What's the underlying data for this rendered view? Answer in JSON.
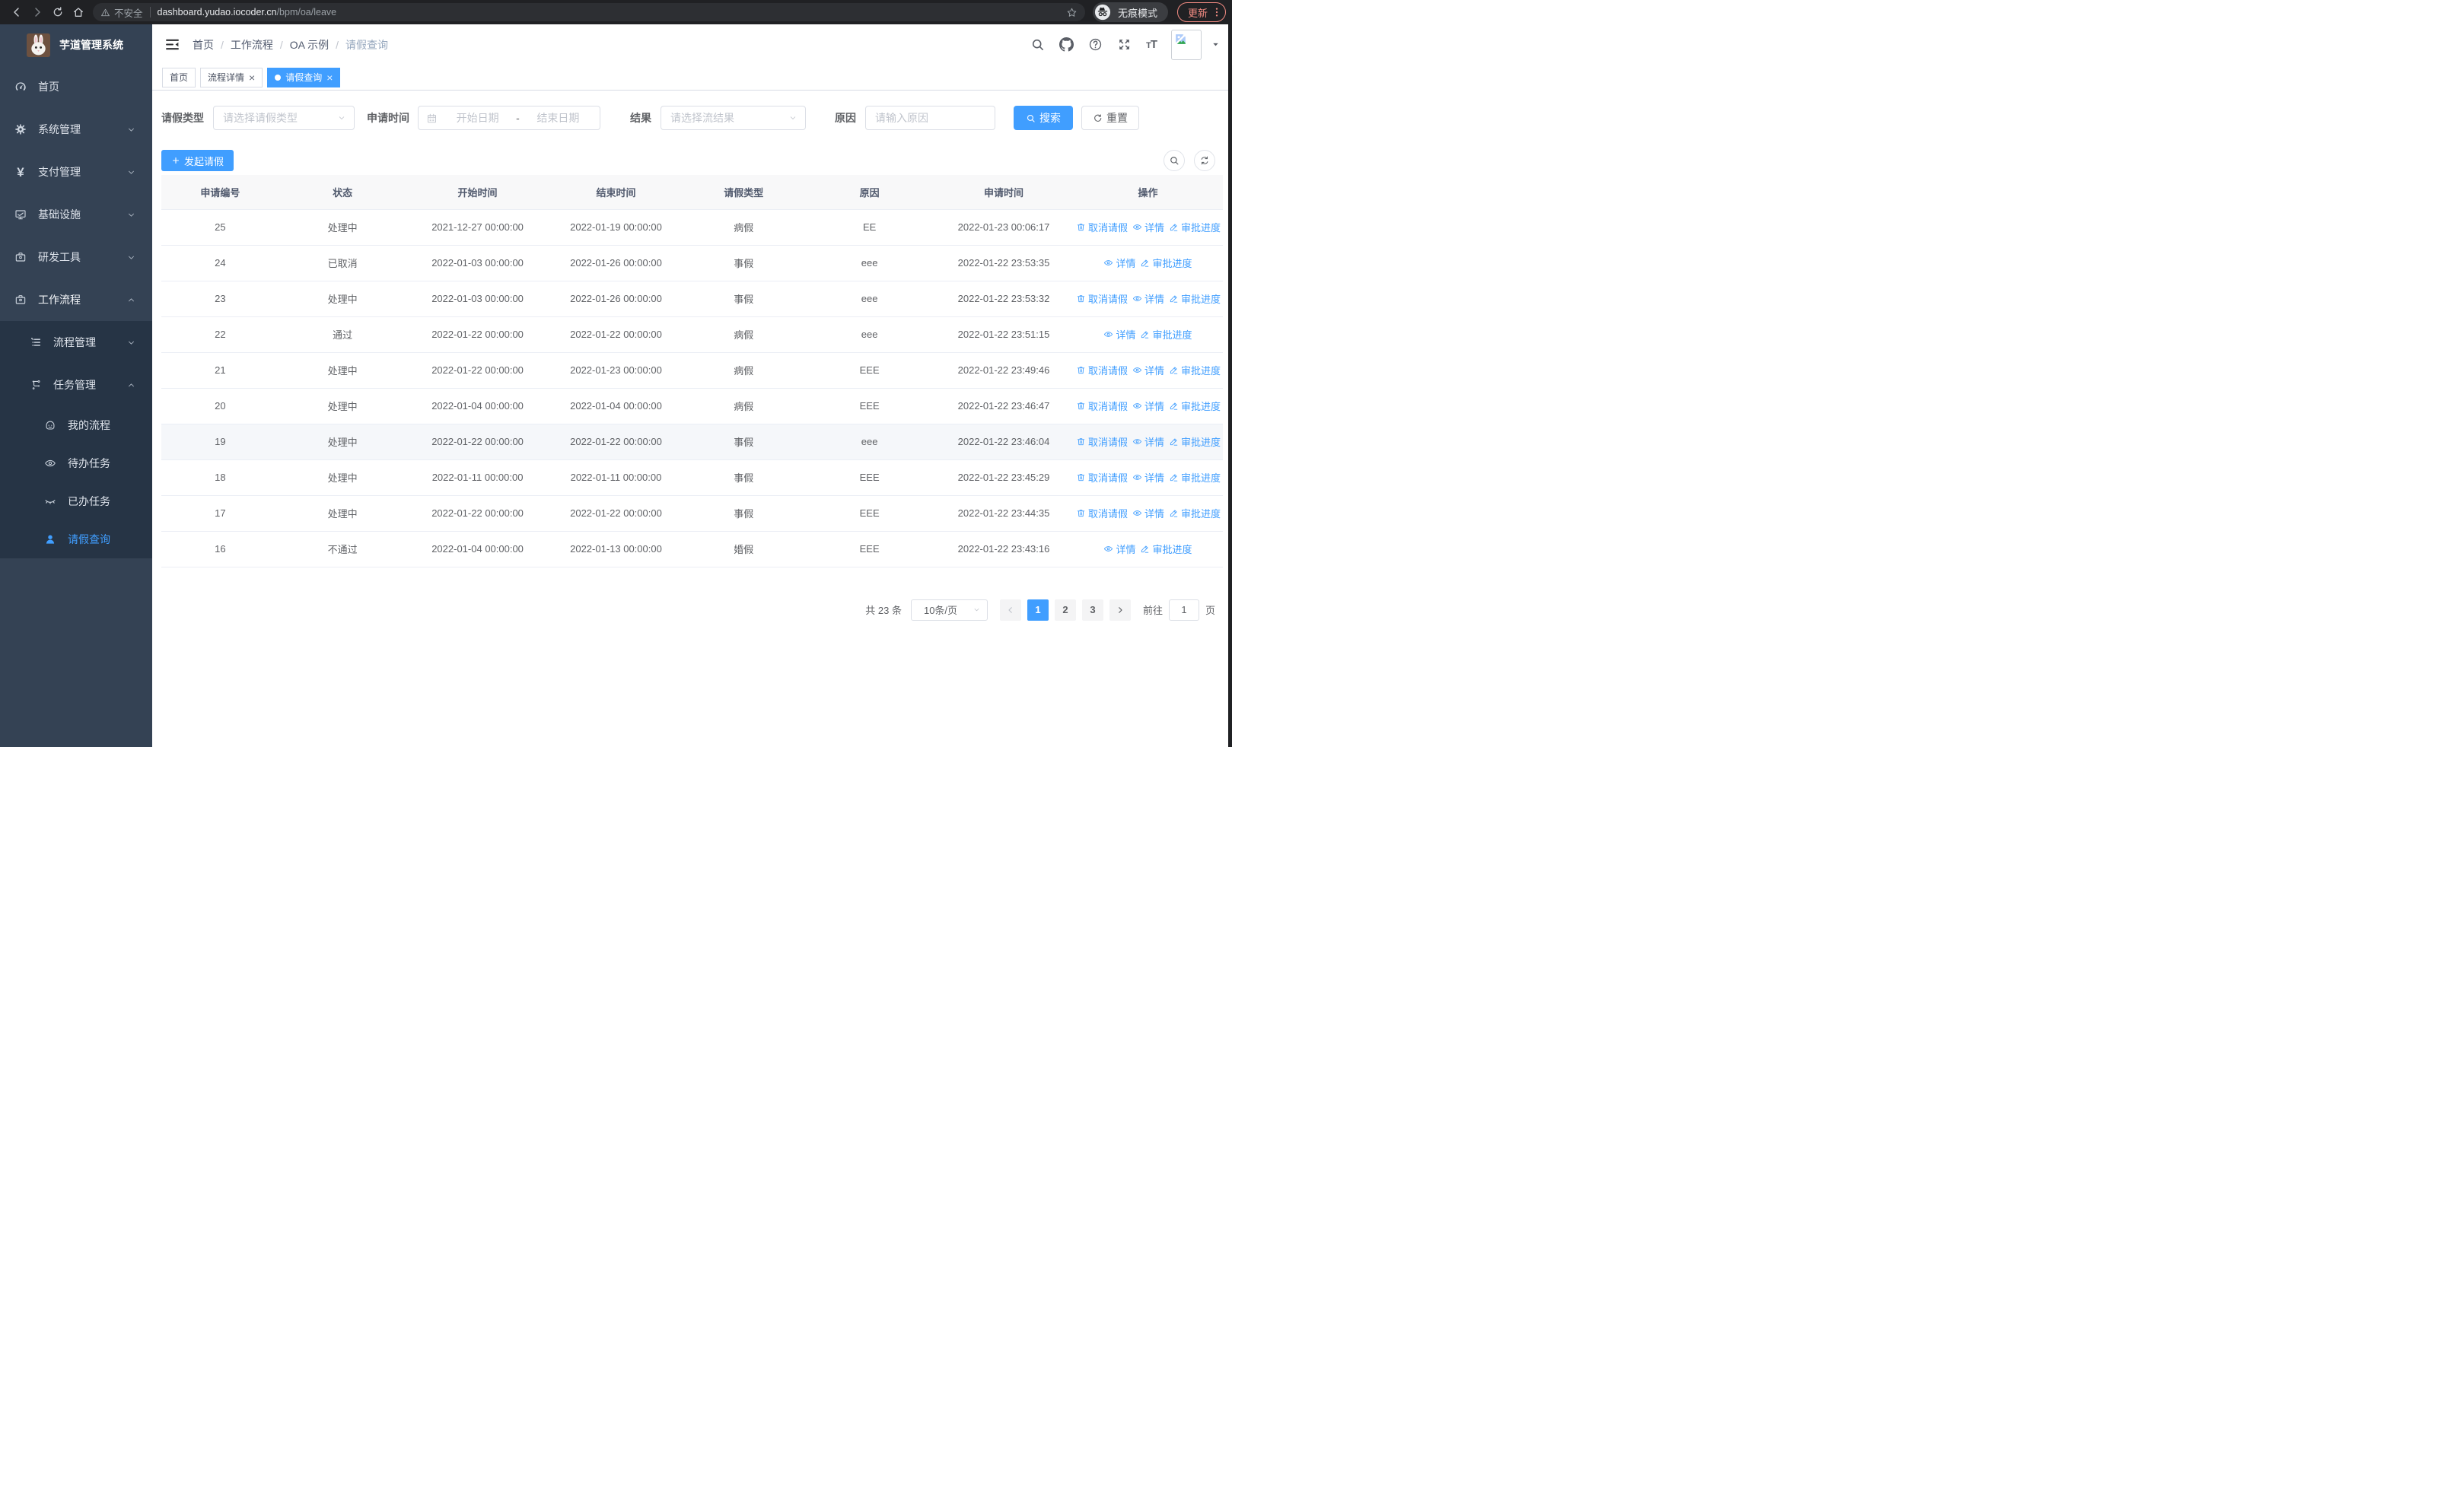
{
  "colors": {
    "accent": "#409eff",
    "sidebar_bg": "#344254",
    "submenu_bg": "#263445",
    "update_accent": "#f28b82"
  },
  "browser": {
    "security_label": "不安全",
    "url_host": "dashboard.yudao.iocoder.cn",
    "url_path": "/bpm/oa/leave",
    "incognito_label": "无痕模式",
    "update_label": "更新"
  },
  "sidebar": {
    "title": "芋道管理系统",
    "items": [
      {
        "label": "首页",
        "icon": "dashboard-icon",
        "level": 0
      },
      {
        "label": "系统管理",
        "icon": "gear-icon",
        "level": 0,
        "arrow": "down"
      },
      {
        "label": "支付管理",
        "icon": "yen-icon",
        "level": 0,
        "arrow": "down"
      },
      {
        "label": "基础设施",
        "icon": "monitor-icon",
        "level": 0,
        "arrow": "down"
      },
      {
        "label": "研发工具",
        "icon": "toolbox-icon",
        "level": 0,
        "arrow": "down"
      },
      {
        "label": "工作流程",
        "icon": "briefcase-icon",
        "level": 0,
        "arrow": "up",
        "open": true
      },
      {
        "label": "流程管理",
        "icon": "list-icon",
        "level": 1,
        "arrow": "down",
        "sub": true
      },
      {
        "label": "任务管理",
        "icon": "tree-icon",
        "level": 1,
        "arrow": "up",
        "sub": true
      },
      {
        "label": "我的流程",
        "icon": "face-icon",
        "level": 2,
        "sub": true
      },
      {
        "label": "待办任务",
        "icon": "eye-icon",
        "level": 2,
        "sub": true
      },
      {
        "label": "已办任务",
        "icon": "eye-closed-icon",
        "level": 2,
        "sub": true
      },
      {
        "label": "请假查询",
        "icon": "person-icon",
        "level": 2,
        "sub": true,
        "active": true
      }
    ]
  },
  "navbar": {
    "breadcrumb": [
      "首页",
      "工作流程",
      "OA 示例",
      "请假查询"
    ]
  },
  "tabs": [
    {
      "label": "首页",
      "closable": false,
      "active": false
    },
    {
      "label": "流程详情",
      "closable": true,
      "active": false
    },
    {
      "label": "请假查询",
      "closable": true,
      "active": true
    }
  ],
  "filters": {
    "type_label": "请假类型",
    "type_placeholder": "请选择请假类型",
    "time_label": "申请时间",
    "start_placeholder": "开始日期",
    "range_separator": "-",
    "end_placeholder": "结束日期",
    "result_label": "结果",
    "result_placeholder": "请选择流结果",
    "reason_label": "原因",
    "reason_placeholder": "请输入原因",
    "search_label": "搜索",
    "reset_label": "重置"
  },
  "toolbar": {
    "create_label": "发起请假"
  },
  "table": {
    "headers": [
      "申请编号",
      "状态",
      "开始时间",
      "结束时间",
      "请假类型",
      "原因",
      "申请时间",
      "操作"
    ],
    "action_labels": {
      "cancel": "取消请假",
      "detail": "详情",
      "progress": "审批进度"
    },
    "action_icons": {
      "cancel": "trash-icon",
      "detail": "eye-icon",
      "progress": "pen-icon"
    },
    "rows": [
      {
        "id": "25",
        "status": "处理中",
        "start": "2021-12-27 00:00:00",
        "end": "2022-01-19 00:00:00",
        "type": "病假",
        "reason": "EE",
        "apply_time": "2022-01-23 00:06:17",
        "actions": [
          "cancel",
          "detail",
          "progress"
        ],
        "highlight": false
      },
      {
        "id": "24",
        "status": "已取消",
        "start": "2022-01-03 00:00:00",
        "end": "2022-01-26 00:00:00",
        "type": "事假",
        "reason": "eee",
        "apply_time": "2022-01-22 23:53:35",
        "actions": [
          "detail",
          "progress"
        ],
        "highlight": false
      },
      {
        "id": "23",
        "status": "处理中",
        "start": "2022-01-03 00:00:00",
        "end": "2022-01-26 00:00:00",
        "type": "事假",
        "reason": "eee",
        "apply_time": "2022-01-22 23:53:32",
        "actions": [
          "cancel",
          "detail",
          "progress"
        ],
        "highlight": false
      },
      {
        "id": "22",
        "status": "通过",
        "start": "2022-01-22 00:00:00",
        "end": "2022-01-22 00:00:00",
        "type": "病假",
        "reason": "eee",
        "apply_time": "2022-01-22 23:51:15",
        "actions": [
          "detail",
          "progress"
        ],
        "highlight": false
      },
      {
        "id": "21",
        "status": "处理中",
        "start": "2022-01-22 00:00:00",
        "end": "2022-01-23 00:00:00",
        "type": "病假",
        "reason": "EEE",
        "apply_time": "2022-01-22 23:49:46",
        "actions": [
          "cancel",
          "detail",
          "progress"
        ],
        "highlight": false
      },
      {
        "id": "20",
        "status": "处理中",
        "start": "2022-01-04 00:00:00",
        "end": "2022-01-04 00:00:00",
        "type": "病假",
        "reason": "EEE",
        "apply_time": "2022-01-22 23:46:47",
        "actions": [
          "cancel",
          "detail",
          "progress"
        ],
        "highlight": false
      },
      {
        "id": "19",
        "status": "处理中",
        "start": "2022-01-22 00:00:00",
        "end": "2022-01-22 00:00:00",
        "type": "事假",
        "reason": "eee",
        "apply_time": "2022-01-22 23:46:04",
        "actions": [
          "cancel",
          "detail",
          "progress"
        ],
        "highlight": true
      },
      {
        "id": "18",
        "status": "处理中",
        "start": "2022-01-11 00:00:00",
        "end": "2022-01-11 00:00:00",
        "type": "事假",
        "reason": "EEE",
        "apply_time": "2022-01-22 23:45:29",
        "actions": [
          "cancel",
          "detail",
          "progress"
        ],
        "highlight": false
      },
      {
        "id": "17",
        "status": "处理中",
        "start": "2022-01-22 00:00:00",
        "end": "2022-01-22 00:00:00",
        "type": "事假",
        "reason": "EEE",
        "apply_time": "2022-01-22 23:44:35",
        "actions": [
          "cancel",
          "detail",
          "progress"
        ],
        "highlight": false
      },
      {
        "id": "16",
        "status": "不通过",
        "start": "2022-01-04 00:00:00",
        "end": "2022-01-13 00:00:00",
        "type": "婚假",
        "reason": "EEE",
        "apply_time": "2022-01-22 23:43:16",
        "actions": [
          "detail",
          "progress"
        ],
        "highlight": false
      }
    ]
  },
  "pagination": {
    "total_label": "共 23 条",
    "page_size": "10条/页",
    "pages": [
      "1",
      "2",
      "3"
    ],
    "active_page": "1",
    "goto_label": "前往",
    "goto_value": "1",
    "goto_suffix": "页"
  }
}
